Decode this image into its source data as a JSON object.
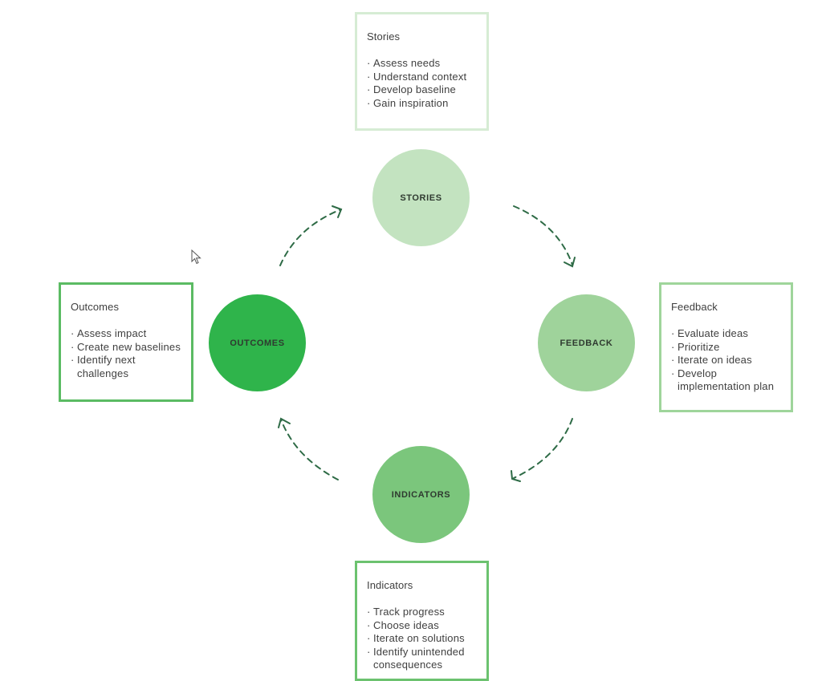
{
  "diagram": {
    "type": "cycle",
    "flow_direction": "clockwise",
    "stages": [
      {
        "key": "stories",
        "circle_label": "STORIES",
        "box_title": "Stories",
        "items": [
          "Assess needs",
          "Understand context",
          "Develop baseline",
          "Gain inspiration"
        ],
        "color": "#c3e3c0"
      },
      {
        "key": "feedback",
        "circle_label": "FEEDBACK",
        "box_title": "Feedback",
        "items": [
          "Evaluate ideas",
          "Prioritize",
          "Iterate on ideas",
          "Develop implementation plan"
        ],
        "color": "#9fd39b"
      },
      {
        "key": "indicators",
        "circle_label": "INDICATORS",
        "box_title": "Indicators",
        "items": [
          "Track progress",
          "Choose ideas",
          "Iterate on solutions",
          "Identify unintended consequences"
        ],
        "color": "#7bc67c"
      },
      {
        "key": "outcomes",
        "circle_label": "OUTCOMES",
        "box_title": "Outcomes",
        "items": [
          "Assess impact",
          "Create new baselines",
          "Identify next challenges"
        ],
        "color": "#2fb44b"
      }
    ],
    "arrows": [
      {
        "from": "stories",
        "to": "feedback"
      },
      {
        "from": "feedback",
        "to": "indicators"
      },
      {
        "from": "indicators",
        "to": "outcomes"
      },
      {
        "from": "outcomes",
        "to": "stories"
      }
    ],
    "arrow_color": "#2e6b46"
  }
}
